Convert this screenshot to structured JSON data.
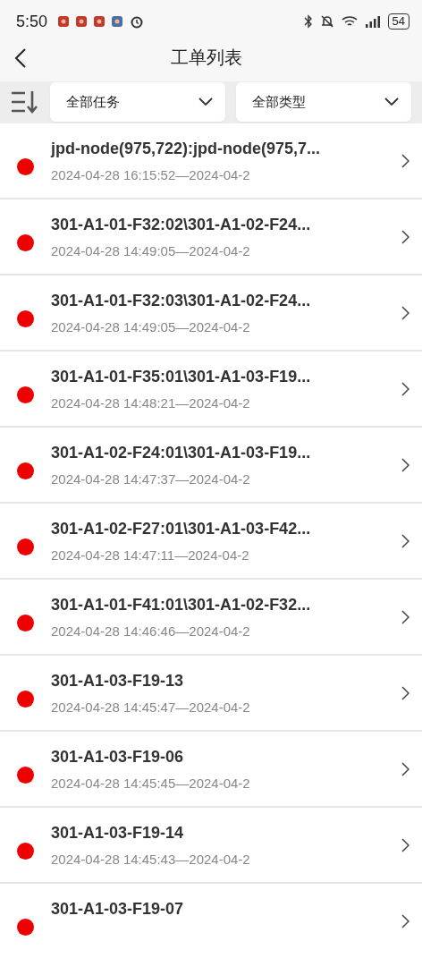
{
  "status_bar": {
    "time": "5:50",
    "battery": "54"
  },
  "header": {
    "title": "工单列表"
  },
  "filters": [
    {
      "label": "全部任务"
    },
    {
      "label": "全部类型"
    }
  ],
  "orders": [
    {
      "title": "jpd-node(975,722):jpd-node(975,7...",
      "time": "2024-04-28 16:15:52—2024-04-2"
    },
    {
      "title": "301-A1-01-F32:02\\301-A1-02-F24...",
      "time": "2024-04-28 14:49:05—2024-04-2"
    },
    {
      "title": "301-A1-01-F32:03\\301-A1-02-F24...",
      "time": "2024-04-28 14:49:05—2024-04-2"
    },
    {
      "title": "301-A1-01-F35:01\\301-A1-03-F19...",
      "time": "2024-04-28 14:48:21—2024-04-2"
    },
    {
      "title": "301-A1-02-F24:01\\301-A1-03-F19...",
      "time": "2024-04-28 14:47:37—2024-04-2"
    },
    {
      "title": "301-A1-02-F27:01\\301-A1-03-F42...",
      "time": "2024-04-28 14:47:11—2024-04-2"
    },
    {
      "title": "301-A1-01-F41:01\\301-A1-02-F32...",
      "time": "2024-04-28 14:46:46—2024-04-2"
    },
    {
      "title": "301-A1-03-F19-13",
      "time": "2024-04-28 14:45:47—2024-04-2"
    },
    {
      "title": "301-A1-03-F19-06",
      "time": "2024-04-28 14:45:45—2024-04-2"
    },
    {
      "title": "301-A1-03-F19-14",
      "time": "2024-04-28 14:45:43—2024-04-2"
    },
    {
      "title": "301-A1-03-F19-07"
    }
  ]
}
